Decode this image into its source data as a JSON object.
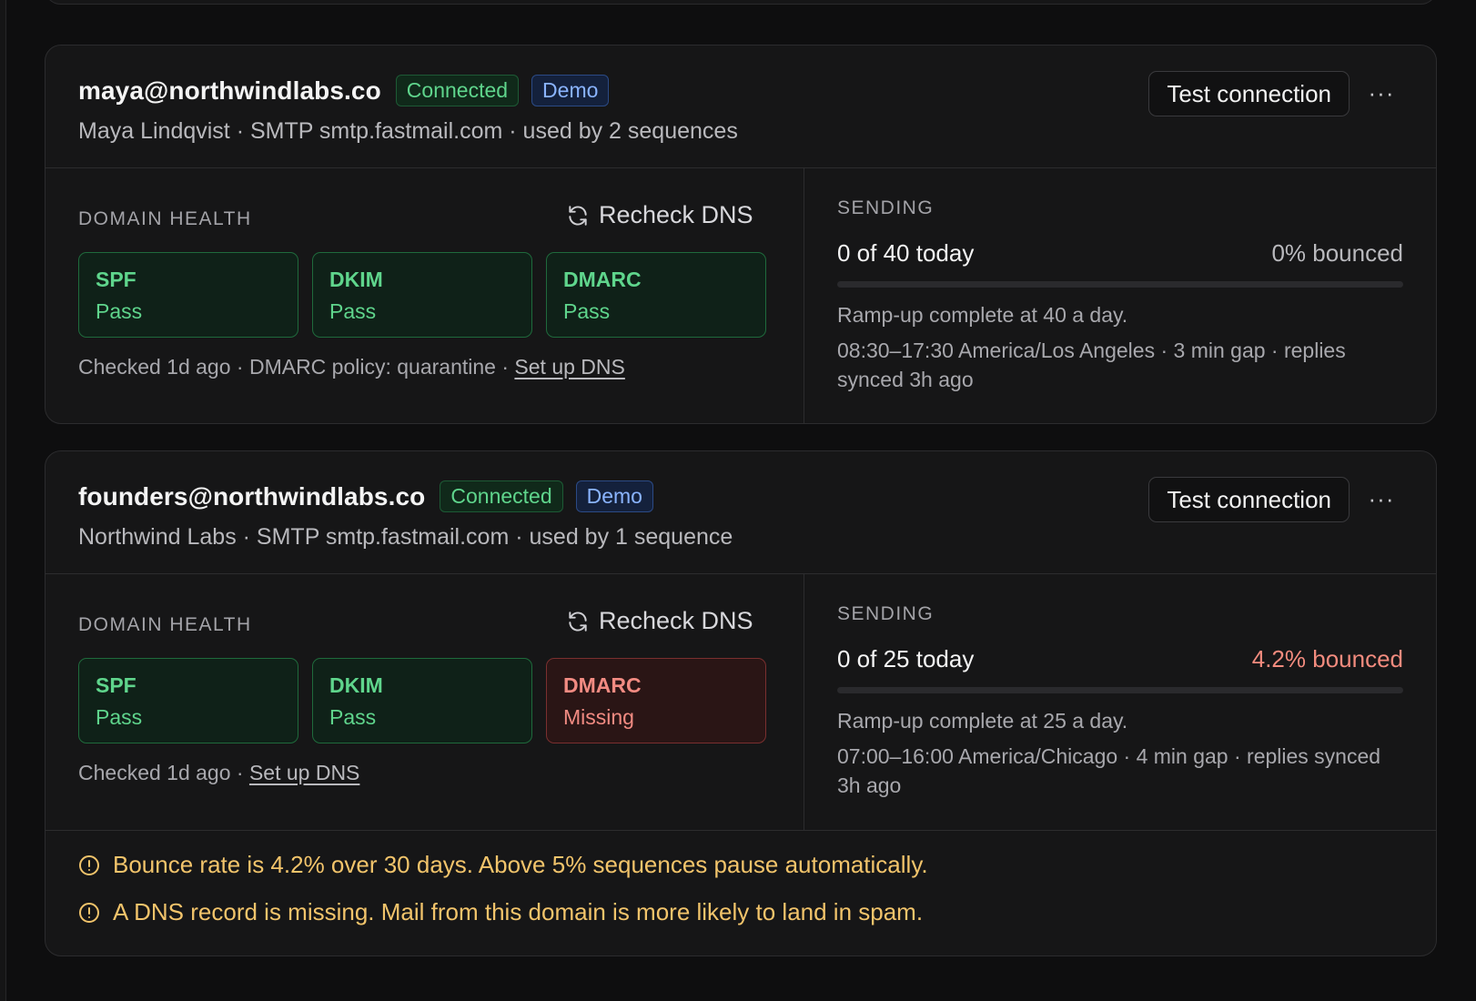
{
  "accounts": [
    {
      "email": "maya@northwindlabs.co",
      "badges": {
        "connected": "Connected",
        "demo": "Demo"
      },
      "subline": "Maya Lindqvist · SMTP smtp.fastmail.com · used by 2 sequences",
      "test_button": "Test connection",
      "more_button": "···",
      "domain_health": {
        "label": "DOMAIN HEALTH",
        "recheck_label": "Recheck DNS",
        "records": [
          {
            "name": "SPF",
            "status": "Pass",
            "state": "pass"
          },
          {
            "name": "DKIM",
            "status": "Pass",
            "state": "pass"
          },
          {
            "name": "DMARC",
            "status": "Pass",
            "state": "pass"
          }
        ],
        "checked_text": "Checked 1d ago · DMARC policy: quarantine · ",
        "setup_link": "Set up DNS"
      },
      "sending": {
        "label": "SENDING",
        "count": "0 of 40 today",
        "bounce": "0% bounced",
        "bounce_warning": false,
        "progress": 0,
        "ramp": "Ramp-up complete at 40 a day.",
        "schedule": "08:30–17:30 America/Los Angeles · 3 min gap · replies synced 3h ago"
      }
    },
    {
      "email": "founders@northwindlabs.co",
      "badges": {
        "connected": "Connected",
        "demo": "Demo"
      },
      "subline": "Northwind Labs · SMTP smtp.fastmail.com · used by 1 sequence",
      "test_button": "Test connection",
      "more_button": "···",
      "domain_health": {
        "label": "DOMAIN HEALTH",
        "recheck_label": "Recheck DNS",
        "records": [
          {
            "name": "SPF",
            "status": "Pass",
            "state": "pass"
          },
          {
            "name": "DKIM",
            "status": "Pass",
            "state": "pass"
          },
          {
            "name": "DMARC",
            "status": "Missing",
            "state": "fail"
          }
        ],
        "checked_text": "Checked 1d ago · ",
        "setup_link": "Set up DNS"
      },
      "sending": {
        "label": "SENDING",
        "count": "0 of 25 today",
        "bounce": "4.2% bounced",
        "bounce_warning": true,
        "progress": 0,
        "ramp": "Ramp-up complete at 25 a day.",
        "schedule": "07:00–16:00 America/Chicago · 4 min gap · replies synced 3h ago"
      },
      "warnings": [
        "Bounce rate is 4.2% over 30 days. Above 5% sequences pause automatically.",
        "A DNS record is missing. Mail from this domain is more likely to land in spam."
      ]
    }
  ],
  "colors": {
    "pass": "#5fd58c",
    "fail": "#f28b82",
    "warning": "#f2c46b",
    "demo": "#8ab4ff"
  },
  "icons": {
    "recheck": "refresh-icon",
    "warning": "alert-circle-icon",
    "more": "ellipsis-icon"
  }
}
